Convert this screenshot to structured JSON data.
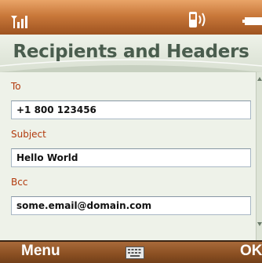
{
  "title": "Recipients and Headers",
  "fields": [
    {
      "label": "To",
      "value": "+1 800 123456"
    },
    {
      "label": "Subject",
      "value": "Hello World"
    },
    {
      "label": "Bcc",
      "value": "some.email@domain.com"
    }
  ],
  "softkeys": {
    "left": "Menu",
    "right": "OK"
  },
  "icons": {
    "signal": "signal-icon",
    "vibrate": "vibrate-icon",
    "battery": "battery-icon",
    "keyboard": "keyboard-icon"
  },
  "colors": {
    "status_bar": "#c9783a",
    "title_text": "#4a5d4e",
    "label_text": "#b23a0d",
    "softkey_bar": "#8a4f22"
  }
}
